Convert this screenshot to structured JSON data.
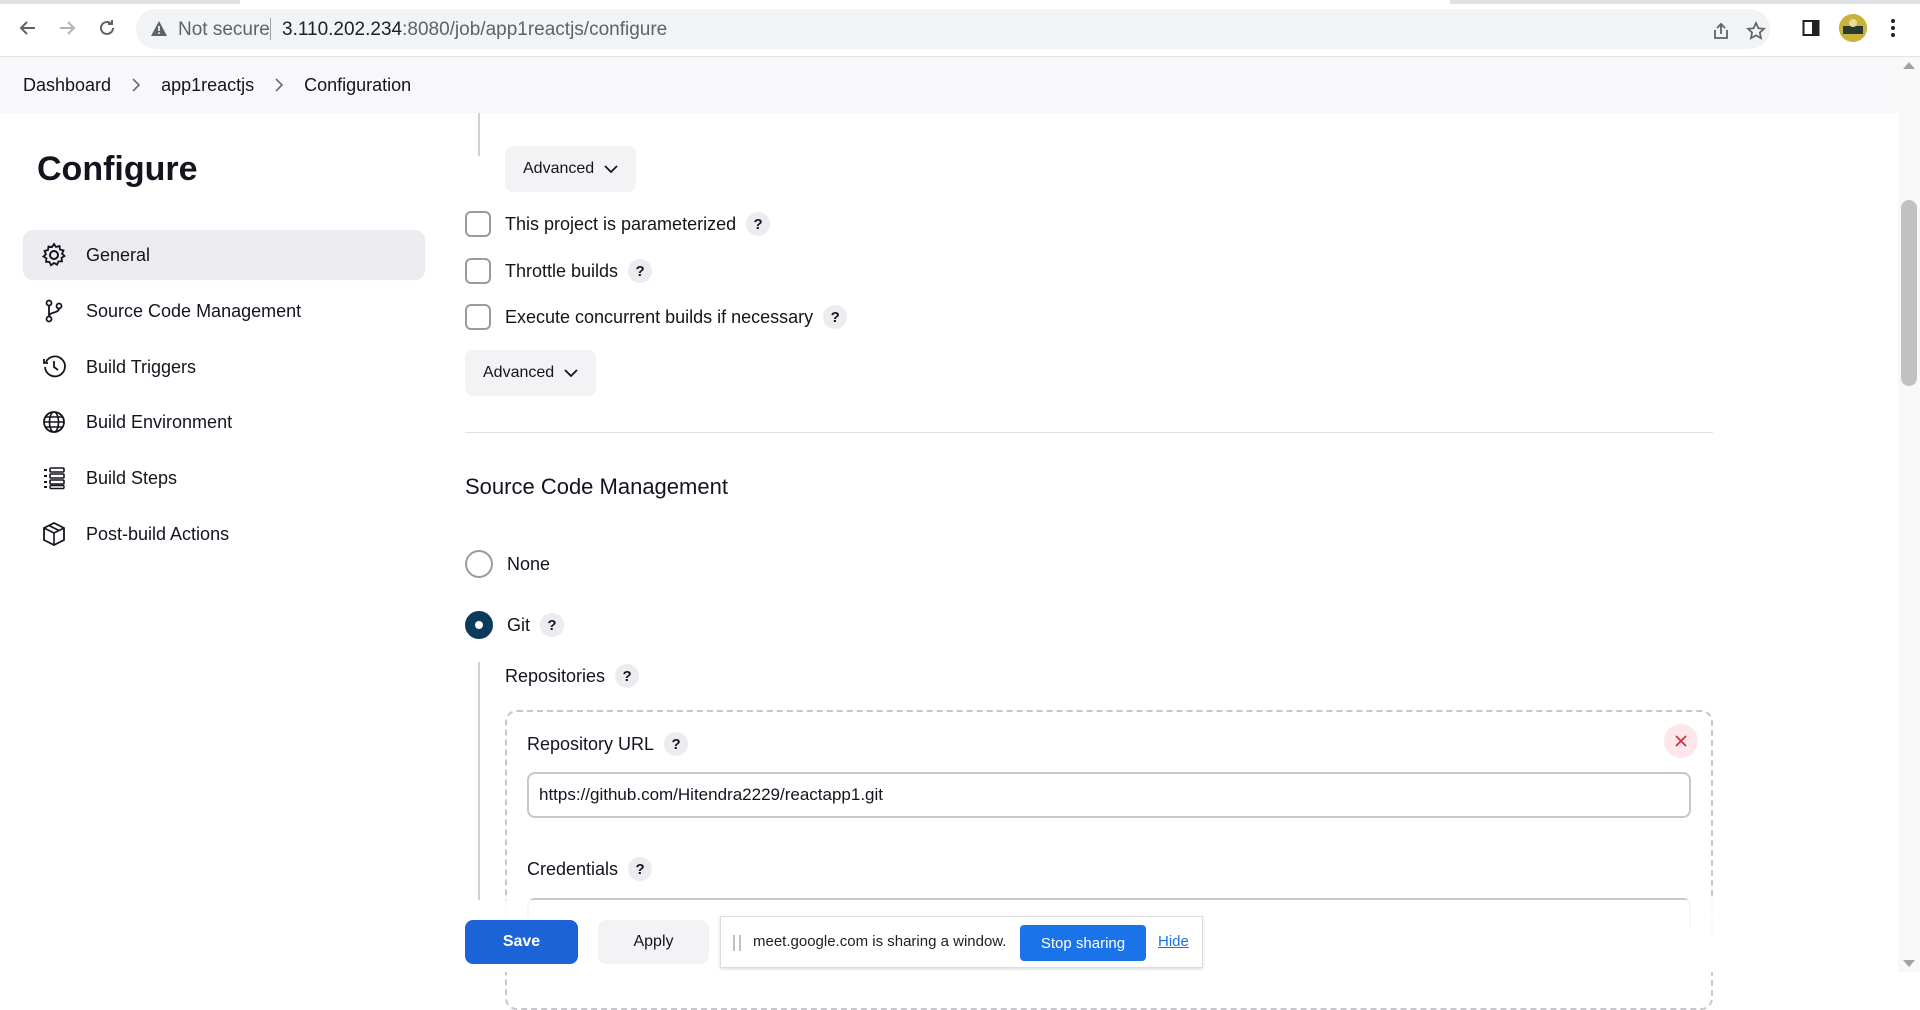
{
  "browser": {
    "security_label": "Not secure",
    "url_host": "3.110.202.234",
    "url_rest": ":8080/job/app1reactjs/configure"
  },
  "breadcrumb": [
    "Dashboard",
    "app1reactjs",
    "Configuration"
  ],
  "sidebar": {
    "title": "Configure",
    "items": [
      {
        "label": "General",
        "icon": "gear-icon"
      },
      {
        "label": "Source Code Management",
        "icon": "branch-icon"
      },
      {
        "label": "Build Triggers",
        "icon": "clock-icon"
      },
      {
        "label": "Build Environment",
        "icon": "globe-icon"
      },
      {
        "label": "Build Steps",
        "icon": "list-icon"
      },
      {
        "label": "Post-build Actions",
        "icon": "package-icon"
      }
    ]
  },
  "general": {
    "advanced_top": "Advanced",
    "options": [
      {
        "label": "This project is parameterized",
        "checked": false
      },
      {
        "label": "Throttle builds",
        "checked": false
      },
      {
        "label": "Execute concurrent builds if necessary",
        "checked": false
      }
    ],
    "advanced_bottom": "Advanced"
  },
  "scm": {
    "title": "Source Code Management",
    "options": [
      {
        "label": "None",
        "selected": false
      },
      {
        "label": "Git",
        "selected": true
      }
    ],
    "repositories_label": "Repositories",
    "repo_url_label": "Repository URL",
    "repo_url_value": "https://github.com/Hitendra2229/reactapp1.git",
    "credentials_label": "Credentials"
  },
  "help_symbol": "?",
  "actions": {
    "save": "Save",
    "apply": "Apply"
  },
  "share": {
    "text": "meet.google.com is sharing a window.",
    "stop": "Stop sharing",
    "hide": "Hide"
  },
  "colors": {
    "primary": "#1d63d8",
    "radio_checked": "#0b3a5c",
    "stop_sharing": "#1a73e8"
  }
}
